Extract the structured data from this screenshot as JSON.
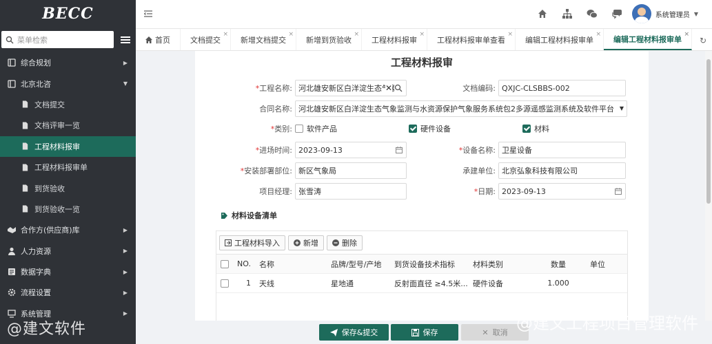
{
  "sidebar": {
    "logo": "BECC",
    "search_placeholder": "菜单检索",
    "items": [
      {
        "label": "综合规划",
        "icon": "book-icon",
        "level": 0,
        "caret": "▶"
      },
      {
        "label": "北京北咨",
        "icon": "book-icon",
        "level": 0,
        "caret": "▼"
      },
      {
        "label": "文档提交",
        "icon": "doc-icon",
        "level": 1
      },
      {
        "label": "文档评审一览",
        "icon": "doc-icon",
        "level": 1
      },
      {
        "label": "工程材料报审",
        "icon": "doc-icon",
        "level": 1,
        "active": true
      },
      {
        "label": "工程材料报审单",
        "icon": "doc-icon",
        "level": 1
      },
      {
        "label": "到货验收",
        "icon": "doc-icon",
        "level": 1
      },
      {
        "label": "到货验收一览",
        "icon": "doc-icon",
        "level": 1
      },
      {
        "label": "合作方(供应商)库",
        "icon": "handshake-icon",
        "level": 0,
        "caret": "▶"
      },
      {
        "label": "人力资源",
        "icon": "person-icon",
        "level": 0,
        "caret": "▶"
      },
      {
        "label": "数据字典",
        "icon": "dictionary-icon",
        "level": 0,
        "caret": "▶"
      },
      {
        "label": "流程设置",
        "icon": "gear-icon",
        "level": 0,
        "caret": "▶"
      },
      {
        "label": "系统管理",
        "icon": "system-icon",
        "level": 0,
        "caret": "▶"
      }
    ],
    "watermark": "@建文软件"
  },
  "topbar": {
    "user_name": "系统管理员",
    "user_caret": "▼"
  },
  "tabs": [
    {
      "label": "首页",
      "home": true
    },
    {
      "label": "文档提交"
    },
    {
      "label": "新增文档提交"
    },
    {
      "label": "新增到货验收"
    },
    {
      "label": "工程材料报审"
    },
    {
      "label": "工程材料报审单查看"
    },
    {
      "label": "编辑工程材料报审单"
    },
    {
      "label": "编辑工程材料报审单",
      "active": true
    }
  ],
  "tab_close": "×",
  "form": {
    "title": "工程材料报审",
    "req_mark": "*",
    "project_name_label": "工程名称:",
    "project_name_value": "河北雄安新区白洋淀生态气象",
    "doc_code_label": "文档编码:",
    "doc_code_value": "QXJC-CLSBBS-002",
    "contract_label": "合同名称:",
    "contract_value": "河北雄安新区白洋淀生态气象监测与水资源保护气象服务系统包2多源遥感监测系统及软件平台",
    "category_label": "类别:",
    "categories": [
      {
        "label": "软件产品",
        "checked": false
      },
      {
        "label": "硬件设备",
        "checked": true
      },
      {
        "label": "材料",
        "checked": true
      }
    ],
    "entry_time_label": "进场时间:",
    "entry_time_value": "2023-09-13",
    "device_name_label": "设备名称:",
    "device_name_value": "卫星设备",
    "install_dept_label": "安装部署部位:",
    "install_dept_value": "新区气象局",
    "contractor_label": "承建单位:",
    "contractor_value": "北京弘象科技有限公司",
    "pm_label": "项目经理:",
    "pm_value": "张雪涛",
    "date_label": "日期:",
    "date_value": "2023-09-13",
    "clear_glyph": "✕"
  },
  "materials": {
    "section_title": "材料设备清单",
    "buttons": {
      "import": "工程材料导入",
      "add": "新增",
      "delete": "删除"
    },
    "columns": [
      "NO.",
      "名称",
      "品牌/型号/产地",
      "到货设备技术指标",
      "材料类别",
      "数量",
      "单位"
    ],
    "rows": [
      {
        "no": "1",
        "name": "天线",
        "brand": "星地通",
        "spec": "反射面直径 ≥4.5米...",
        "category": "硬件设备",
        "qty": "1.000",
        "unit": ""
      }
    ]
  },
  "footer": {
    "save_submit": "保存&提交",
    "save": "保存",
    "cancel": "取消",
    "watermark": "@建文工程项目管理软件"
  },
  "colors": {
    "accent": "#1d6b5b",
    "sidebar_bg": "#2f3237"
  }
}
